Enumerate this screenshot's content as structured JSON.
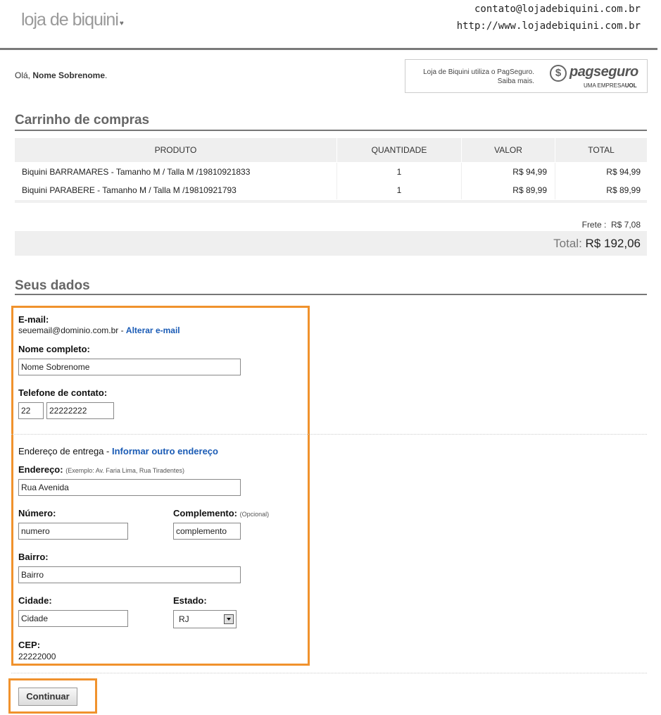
{
  "header": {
    "logo_text": "loja de biquini",
    "email": "contato@lojadebiquini.com.br",
    "url": "http://www.lojadebiquini.com.br"
  },
  "greeting": {
    "prefix": "Olá, ",
    "name": "Nome Sobrenome",
    "suffix": "."
  },
  "pagseguro": {
    "line1": "Loja de Biquini utiliza o PagSeguro.",
    "line2": "Saiba mais.",
    "logo_word": "pagseguro",
    "logo_sub_prefix": "UMA EMPRESA",
    "logo_sub_brand": "UOL"
  },
  "cart": {
    "title": "Carrinho de compras",
    "columns": [
      "PRODUTO",
      "QUANTIDADE",
      "VALOR",
      "TOTAL"
    ],
    "rows": [
      {
        "product": "Biquini BARRAMARES - Tamanho M / Talla M /19810921833",
        "qty": "1",
        "value": "R$ 94,99",
        "total": "R$ 94,99"
      },
      {
        "product": "Biquini PARABERE - Tamanho M / Talla M /19810921793",
        "qty": "1",
        "value": "R$ 89,99",
        "total": "R$ 89,99"
      }
    ],
    "frete_label": "Frete :",
    "frete_value": "R$ 7,08",
    "total_label": "Total:",
    "total_value": "R$ 192,06"
  },
  "form": {
    "title": "Seus dados",
    "email_label": "E-mail:",
    "email_value": "seuemail@dominio.com.br",
    "email_sep": " - ",
    "change_email_link": "Alterar e-mail",
    "name_label": "Nome completo:",
    "name_value": "Nome Sobrenome",
    "phone_label": "Telefone de contato:",
    "phone_ddd": "22",
    "phone_number": "22222222",
    "delivery_label": "Endereço de entrega",
    "delivery_sep": " - ",
    "other_address_link": "Informar outro endereço",
    "address_label": "Endereço:",
    "address_hint": "(Exemplo: Av. Faria Lima, Rua Tiradentes)",
    "address_value": "Rua Avenida",
    "number_label": "Número:",
    "number_value": "numero",
    "complement_label": "Complemento:",
    "complement_hint": "(Opcional)",
    "complement_value": "complemento",
    "district_label": "Bairro:",
    "district_value": "Bairro",
    "city_label": "Cidade:",
    "city_value": "Cidade",
    "state_label": "Estado:",
    "state_value": "RJ",
    "cep_label": "CEP:",
    "cep_value": "22222000"
  },
  "continue_label": "Continuar",
  "colors": {
    "highlight": "#f0922d",
    "link": "#1a5bb5"
  }
}
